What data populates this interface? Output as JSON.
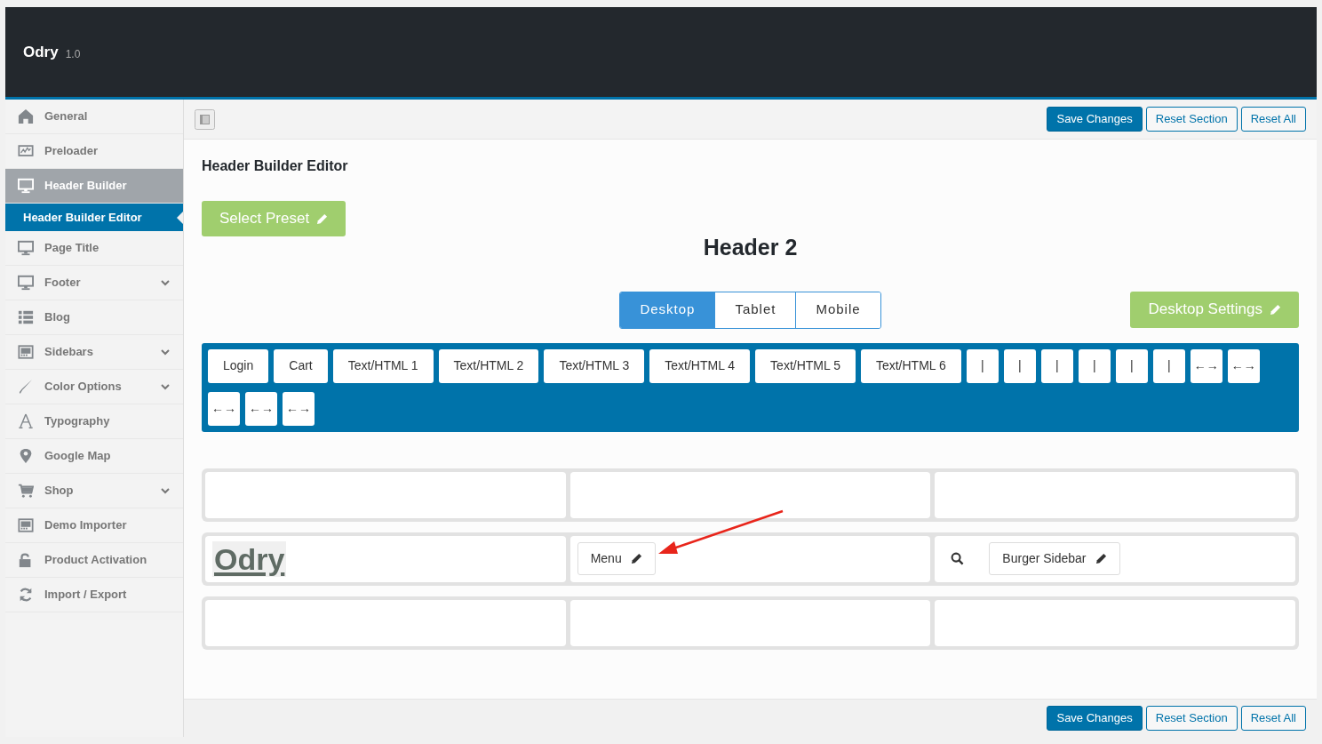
{
  "header": {
    "title": "Odry",
    "version": "1.0"
  },
  "sidebar": {
    "items": [
      {
        "label": "General",
        "selected": false
      },
      {
        "label": "Preloader",
        "selected": false
      },
      {
        "label": "Header Builder",
        "selected": true,
        "children": [
          {
            "label": "Header Builder Editor",
            "selected": true
          }
        ]
      },
      {
        "label": "Page Title",
        "selected": false
      },
      {
        "label": "Footer",
        "selected": false,
        "expanded": false
      },
      {
        "label": "Blog",
        "selected": false
      },
      {
        "label": "Sidebars",
        "selected": false,
        "expanded": false
      },
      {
        "label": "Color Options",
        "selected": false,
        "expanded": false
      },
      {
        "label": "Typography",
        "selected": false
      },
      {
        "label": "Google Map",
        "selected": false
      },
      {
        "label": "Shop",
        "selected": false,
        "expanded": false
      },
      {
        "label": "Demo Importer",
        "selected": false
      },
      {
        "label": "Product Activation",
        "selected": false
      },
      {
        "label": "Import / Export",
        "selected": false
      }
    ]
  },
  "top_actions": [
    "Save Changes",
    "Reset Section",
    "Reset All"
  ],
  "section_title": "Header Builder Editor",
  "preset_button": "Select Preset",
  "header_name": "Header 2",
  "device_tabs": [
    {
      "label": "Desktop",
      "selected": true
    },
    {
      "label": "Tablet",
      "selected": false
    },
    {
      "label": "Mobile",
      "selected": false
    }
  ],
  "settings_button": "Desktop Settings",
  "palette": [
    "Login",
    "Cart",
    "Text/HTML 1",
    "Text/HTML 2",
    "Text/HTML 3",
    "Text/HTML 4",
    "Text/HTML 5",
    "Text/HTML 6",
    "|",
    "|",
    "|",
    "|",
    "|",
    "|",
    "←→",
    "←→",
    "←→",
    "←→",
    "←→"
  ],
  "rows": [
    {
      "cells": [
        {},
        {},
        {}
      ]
    },
    {
      "cells": [
        {
          "items": [
            {
              "kind": "logo",
              "text": "Odry"
            }
          ]
        },
        {
          "items": [
            {
              "kind": "editable",
              "text": "Menu"
            }
          ]
        },
        {
          "items": [
            {
              "kind": "search"
            },
            {
              "kind": "editable",
              "text": "Burger Sidebar"
            }
          ]
        }
      ]
    },
    {
      "cells": [
        {},
        {},
        {}
      ]
    }
  ],
  "bottom_actions": [
    "Save Changes",
    "Reset Section",
    "Reset All"
  ]
}
